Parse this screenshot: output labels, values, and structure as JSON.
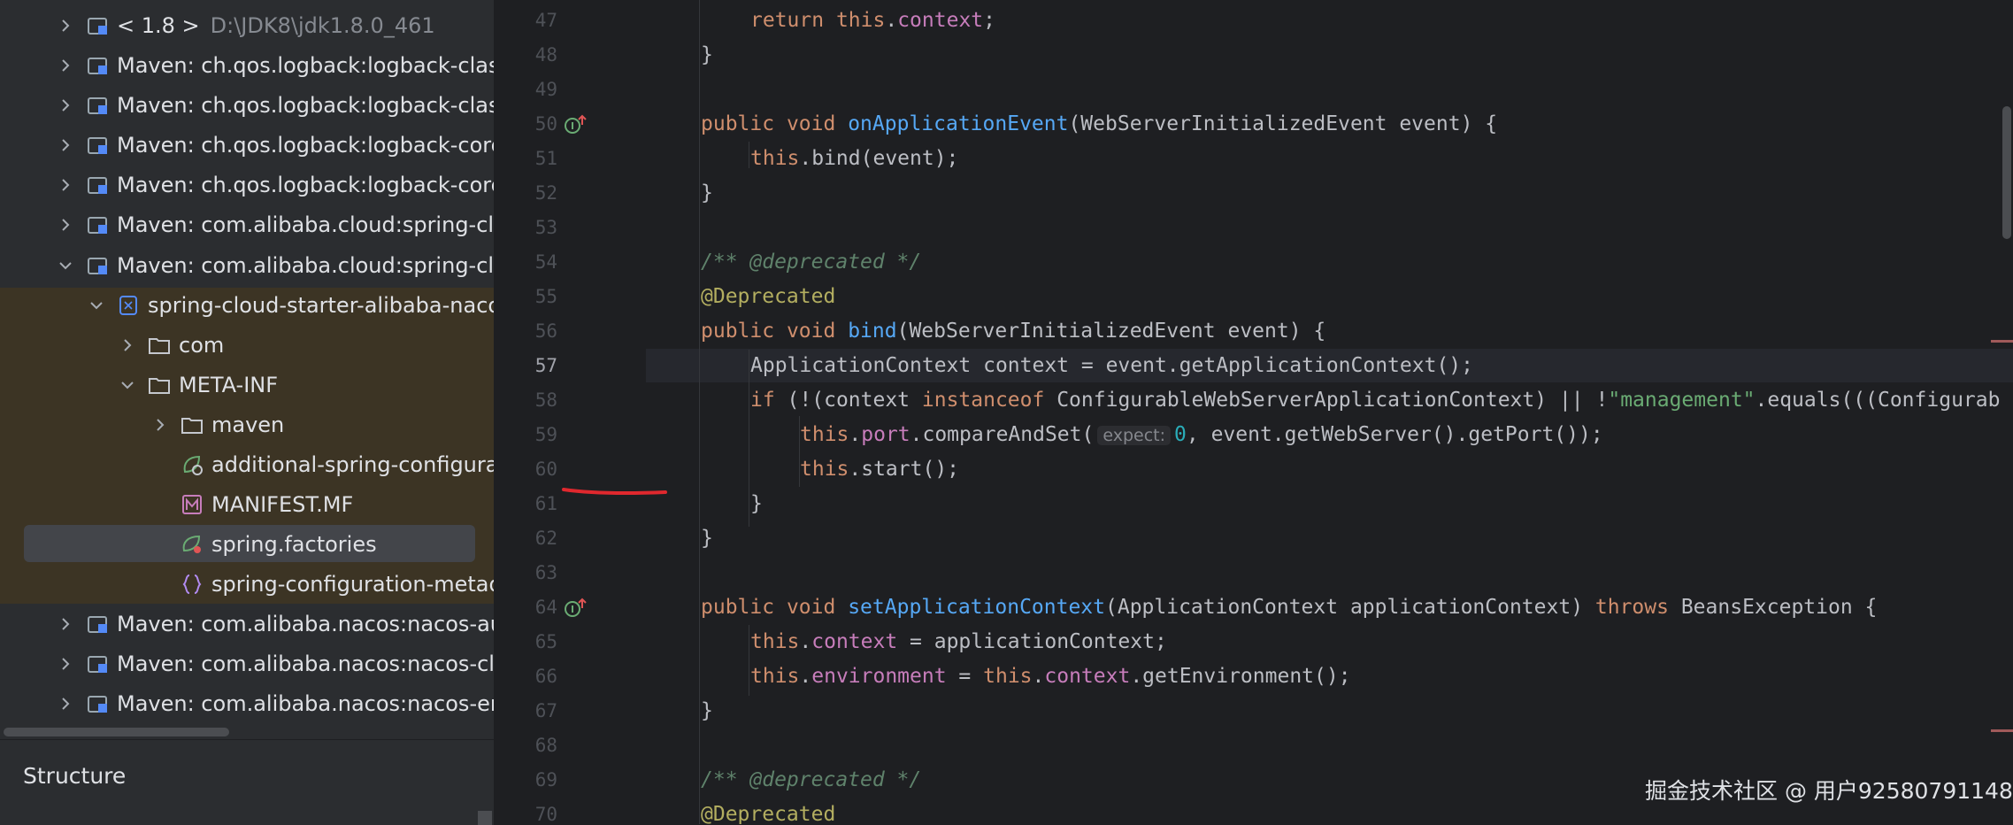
{
  "project_tree": {
    "rows": [
      {
        "label": "< 1.8 >",
        "sub": "D:\\JDK8\\jdk1.8.0_461"
      },
      {
        "label": "Maven: ch.qos.logback:logback-class"
      },
      {
        "label": "Maven: ch.qos.logback:logback-class"
      },
      {
        "label": "Maven: ch.qos.logback:logback-core:"
      },
      {
        "label": "Maven: ch.qos.logback:logback-core:"
      },
      {
        "label": "Maven: com.alibaba.cloud:spring-clou"
      },
      {
        "label": "Maven: com.alibaba.cloud:spring-clou"
      },
      {
        "label": "spring-cloud-starter-alibaba-naco"
      },
      {
        "label": "com"
      },
      {
        "label": "META-INF"
      },
      {
        "label": "maven"
      },
      {
        "label": "additional-spring-configura"
      },
      {
        "label": "MANIFEST.MF"
      },
      {
        "label": "spring.factories"
      },
      {
        "label": "spring-configuration-metad"
      },
      {
        "label": "Maven: com.alibaba.nacos:nacos-aut"
      },
      {
        "label": "Maven: com.alibaba.nacos:nacos-clie"
      },
      {
        "label": "Maven: com.alibaba.nacos:nacos-enc"
      }
    ]
  },
  "structure_panel": {
    "title": "Structure"
  },
  "editor": {
    "line_numbers": [
      "47",
      "48",
      "49",
      "50",
      "51",
      "52",
      "53",
      "54",
      "55",
      "56",
      "57",
      "58",
      "59",
      "60",
      "61",
      "62",
      "63",
      "64",
      "65",
      "66",
      "67",
      "68",
      "69",
      "70"
    ],
    "current_line": "57",
    "hint_expect": "expect:",
    "code": {
      "l47": [
        "return",
        "this",
        ".",
        "context",
        ";"
      ],
      "l48": "}",
      "l50": [
        "public",
        "void",
        "onApplicationEvent",
        "(WebServerInitializedEvent event) {"
      ],
      "l51": [
        "this",
        ".bind(event);"
      ],
      "l52": "}",
      "l54": "/** @deprecated */",
      "l55": "@Deprecated",
      "l56": [
        "public",
        "void",
        "bind",
        "(WebServerInitializedEvent event) {"
      ],
      "l57": "ApplicationContext context = event.getApplicationContext();",
      "l58": [
        "if",
        " (!(context ",
        "instanceof",
        " ConfigurableWebServerApplicationContext) || !",
        "\"management\"",
        ".equals(((Configurab"
      ],
      "l59": [
        "this",
        ".",
        "port",
        ".compareAndSet(",
        "0",
        ", event.getWebServer().getPort());"
      ],
      "l60": [
        "this",
        ".start();"
      ],
      "l61": "}",
      "l62": "}",
      "l64": [
        "public",
        "void",
        "setApplicationContext",
        "(ApplicationContext applicationContext) ",
        "throws",
        " BeansException {"
      ],
      "l65": [
        "this",
        ".",
        "context",
        " = applicationContext;"
      ],
      "l66": [
        "this",
        ".",
        "environment",
        " = ",
        "this",
        ".",
        "context",
        ".getEnvironment();"
      ],
      "l67": "}",
      "l69": "/** @deprecated */",
      "l70": "@Deprecated"
    }
  },
  "watermark": "掘金技术社区 @ 用户92580791148",
  "colors": {
    "keyword": "#cf8e6d",
    "field": "#c77dbb",
    "method": "#56a8f5",
    "string": "#6aab73",
    "number": "#2aacb8",
    "comment": "#5f826b",
    "annotation": "#b3ae60",
    "underline": "#e0282e"
  },
  "icons": [
    "chevron-right-icon",
    "chevron-down-icon",
    "library-icon",
    "module-icon",
    "folder-icon",
    "spring-config-icon",
    "manifest-icon",
    "spring-factories-icon",
    "json-braces-icon",
    "implements-icon"
  ]
}
